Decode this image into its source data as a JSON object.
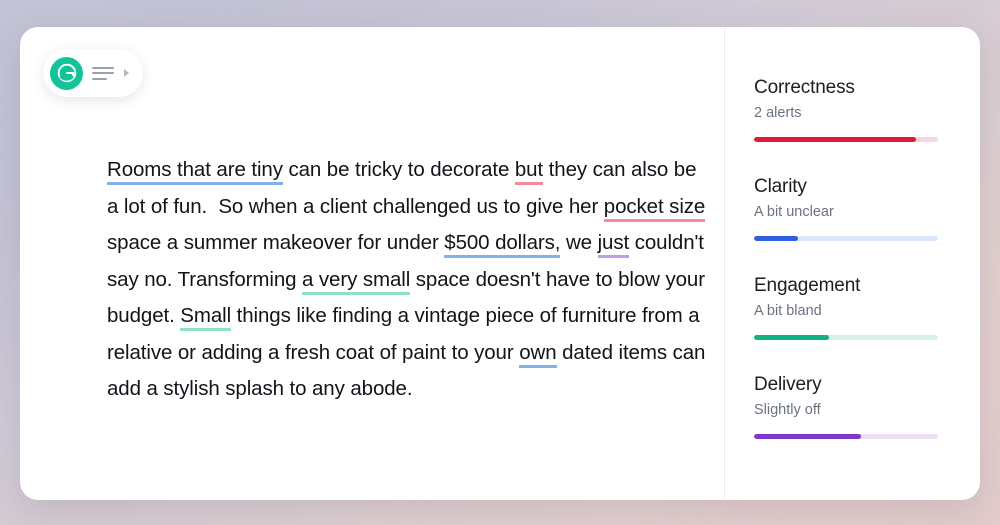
{
  "window": {
    "background_gradient_from": "#b9bbd0",
    "background_gradient_to": "#e7d4d0"
  },
  "toolbar": {
    "logo_name": "grammarly-logo",
    "logo_color": "#15c39a",
    "menu_label": "menu-icon",
    "caret_label": "expand-caret"
  },
  "document": {
    "segments": [
      {
        "text": "Rooms that are tiny",
        "underline": "blue"
      },
      {
        "text": " can be tricky to decorate ",
        "underline": "none"
      },
      {
        "text": "but",
        "underline": "pink"
      },
      {
        "text": " they can also be a lot of fun.  So when a client challenged us to give her ",
        "underline": "none"
      },
      {
        "text": "pocket size",
        "underline": "pink"
      },
      {
        "text": " space a summer makeover for under ",
        "underline": "none"
      },
      {
        "text": "$500 dollars,",
        "underline": "blue"
      },
      {
        "text": " we ",
        "underline": "none"
      },
      {
        "text": "just",
        "underline": "purple"
      },
      {
        "text": " couldn't say no. Transforming ",
        "underline": "none"
      },
      {
        "text": "a very small",
        "underline": "teal"
      },
      {
        "text": " space doesn't have to blow your budget. ",
        "underline": "none"
      },
      {
        "text": "Small",
        "underline": "teal"
      },
      {
        "text": " things like finding a vintage piece of furniture from a relative or adding a fresh coat of paint to your ",
        "underline": "none"
      },
      {
        "text": "own",
        "underline": "blue"
      },
      {
        "text": " dated items can add a stylish splash to any abode.",
        "underline": "none"
      }
    ],
    "underline_colors": {
      "blue": "#84b0ea",
      "pink": "#f5899f",
      "purple": "#bda0e3",
      "teal": "#8fe0c6"
    }
  },
  "assistant": {
    "scores": [
      {
        "title": "Correctness",
        "status": "2 alerts",
        "percent": 88,
        "fill_color": "#e01b37",
        "track_color": "#fbd5dd"
      },
      {
        "title": "Clarity",
        "status": "A bit unclear",
        "percent": 24,
        "fill_color": "#2f5fe0",
        "track_color": "#dce7fa"
      },
      {
        "title": "Engagement",
        "status": "A bit bland",
        "percent": 41,
        "fill_color": "#10b283",
        "track_color": "#d8f0e7"
      },
      {
        "title": "Delivery",
        "status": "Slightly off",
        "percent": 58,
        "fill_color": "#8236c4",
        "track_color": "#efdff4"
      }
    ]
  }
}
